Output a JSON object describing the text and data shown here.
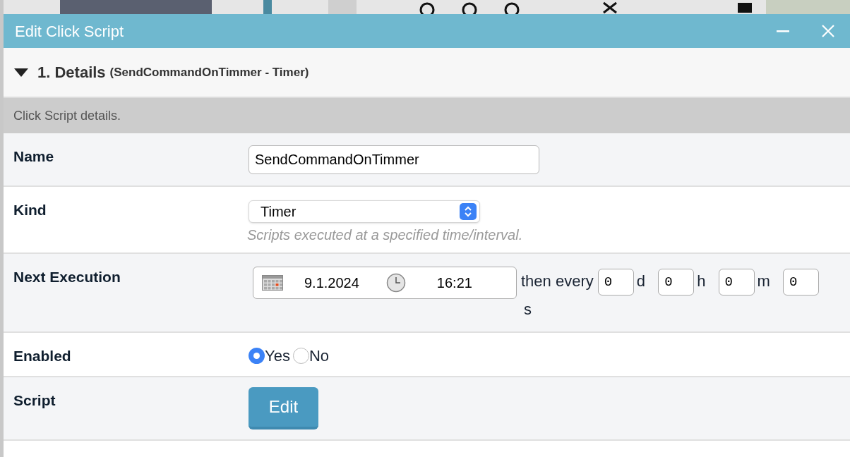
{
  "window": {
    "title": "Edit Click Script"
  },
  "section": {
    "expanded": true,
    "title": "1. Details",
    "subtitle": "(SendCommandOnTimmer - Timer)",
    "description": "Click Script details."
  },
  "fields": [
    {
      "kind": "text",
      "label": "Name",
      "value": "SendCommandOnTimmer"
    },
    {
      "kind": "select",
      "label": "Kind",
      "value": "Timer",
      "hint": "Scripts executed at a specified time/interval."
    },
    {
      "kind": "schedule",
      "label": "Next Execution",
      "date": "9.1.2024",
      "time": "16:21",
      "prefix": "then every",
      "intervals": [
        {
          "value": "0",
          "unit": "d"
        },
        {
          "value": "0",
          "unit": "h"
        },
        {
          "value": "0",
          "unit": "m"
        },
        {
          "value": "0",
          "unit": "s"
        }
      ]
    },
    {
      "kind": "radio",
      "label": "Enabled",
      "options": [
        {
          "label": "Yes",
          "selected": true
        },
        {
          "label": "No",
          "selected": false
        }
      ]
    },
    {
      "kind": "button",
      "label": "Script",
      "button": "Edit"
    }
  ]
}
